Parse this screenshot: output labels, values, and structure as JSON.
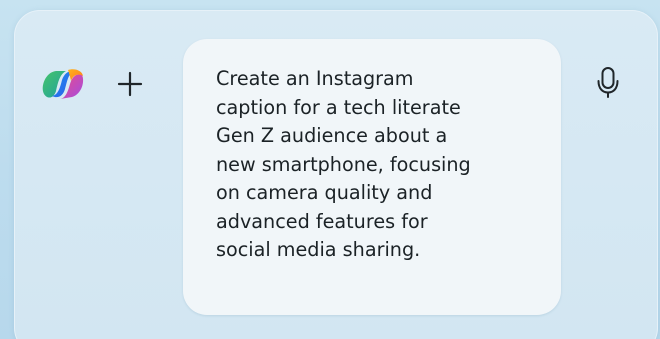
{
  "composer": {
    "logo_icon": "copilot-logo-icon",
    "add_icon": "plus-icon",
    "mic_icon": "microphone-icon",
    "prompt_text": "Create an Instagram\ncaption for a tech literate\nGen Z audience about a\nnew smartphone, focusing\non camera quality and\nadvanced features for\nsocial media sharing."
  },
  "colors": {
    "background": "#c7e3f1",
    "panel": "#d6e8f3",
    "bubble": "#f1f6f9",
    "text": "#1b2226",
    "icon": "#20262a"
  }
}
